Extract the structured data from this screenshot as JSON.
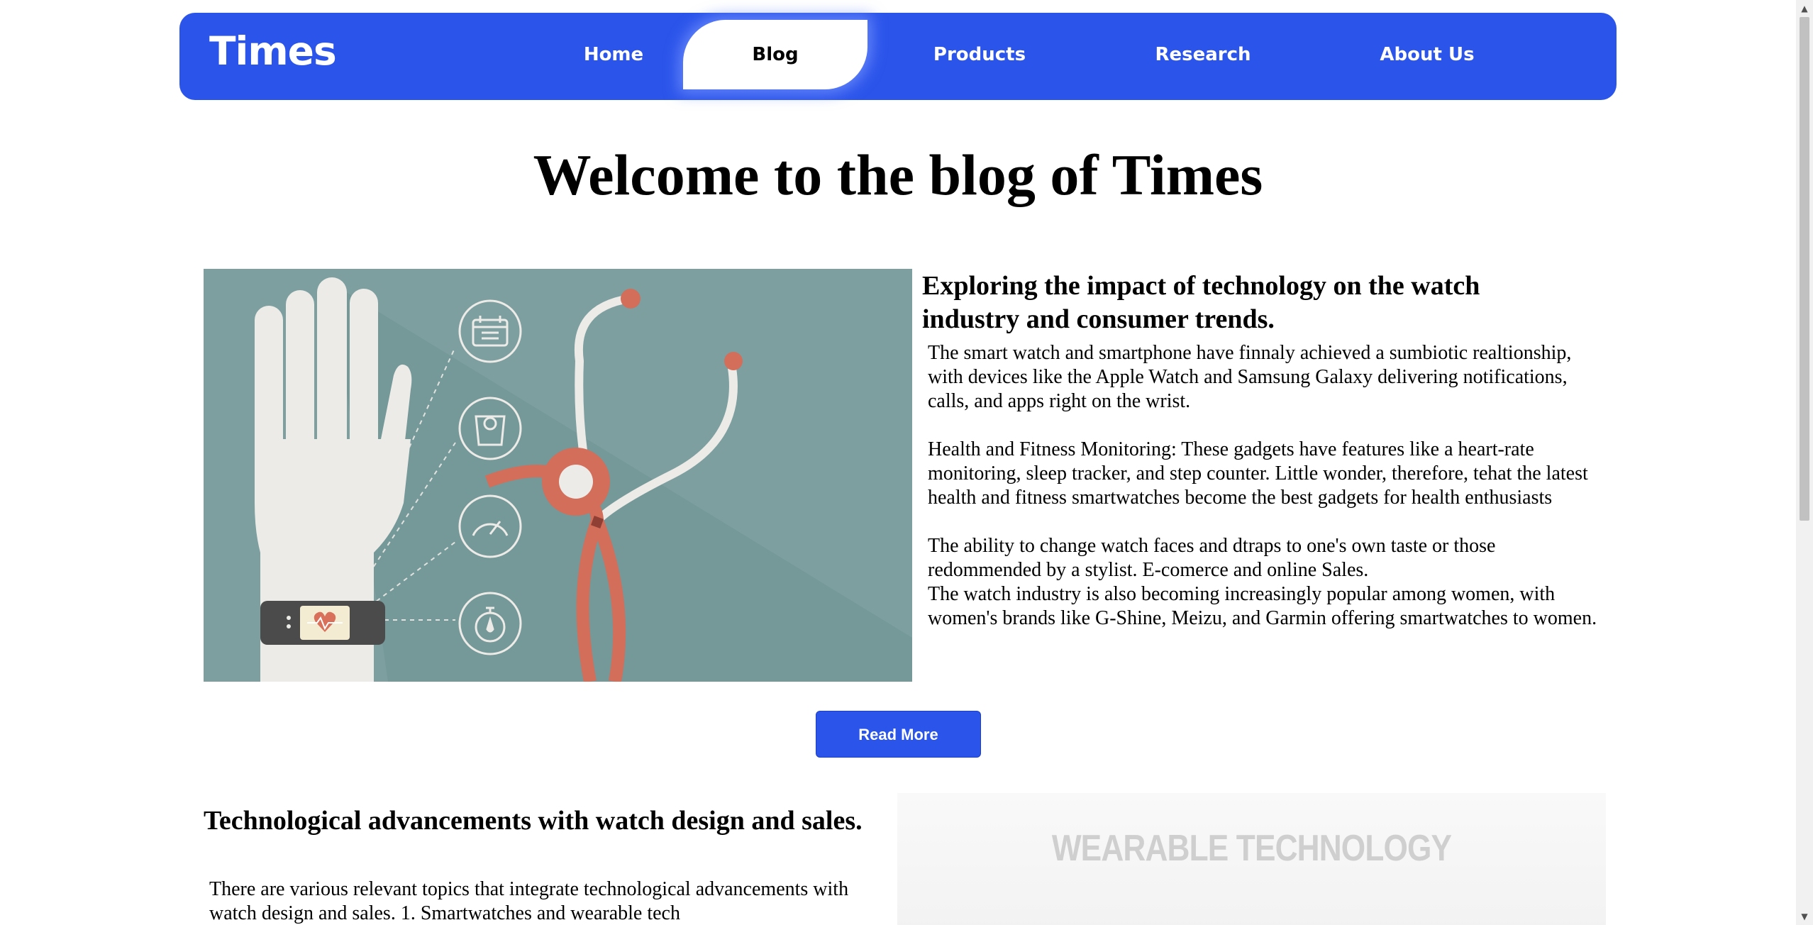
{
  "navbar": {
    "logo": "Times",
    "items": [
      {
        "label": "Home"
      },
      {
        "label": "Blog"
      },
      {
        "label": "Products"
      },
      {
        "label": "Research"
      },
      {
        "label": "About Us"
      }
    ],
    "active_item": "Blog",
    "accent_color": "#2b54ea"
  },
  "page": {
    "title": "Welcome to the blog of Times"
  },
  "article1": {
    "image_icons": [
      "hand-icon",
      "fitness-band-icon",
      "calendar-icon",
      "weight-scale-icon",
      "speedometer-icon",
      "stopwatch-icon",
      "stethoscope-icon"
    ],
    "heading": "Exploring the impact of technology on the watch industry and consumer trends.",
    "paragraphs": [
      "The smart watch and smartphone have finnaly achieved a sumbiotic realtionship, with devices like the Apple Watch and Samsung Galaxy delivering notifications, calls, and apps right on the wrist.",
      "Health and Fitness Monitoring: These gadgets have features like a heart-rate monitoring, sleep tracker, and step counter. Little wonder, therefore, tehat the latest health and fitness smartwatches become the best gadgets for health enthusiasts",
      "The ability to change watch faces and dtraps to one's own taste or those redommended by a stylist. E-comerce and online Sales.",
      "The watch industry is also becoming increasingly popular among women, with women's brands like G-Shine, Meizu, and Garmin offering smartwatches to women."
    ],
    "read_more_label": "Read More"
  },
  "article2": {
    "heading": "Technological advancements with watch design and sales.",
    "body": "There are various relevant topics that integrate technological advancements with watch design and sales. 1. Smartwatches and wearable tech",
    "image_title": "WEARABLE TECHNOLOGY"
  }
}
